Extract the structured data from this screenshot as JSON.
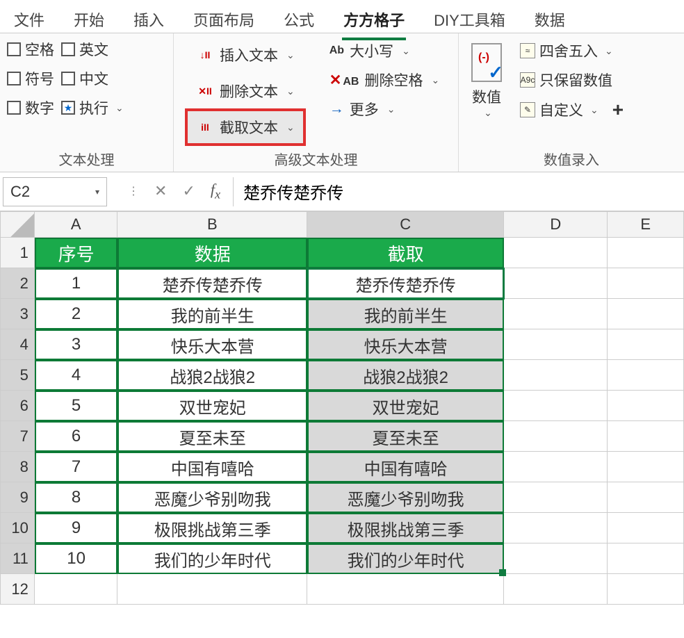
{
  "tabs": [
    "文件",
    "开始",
    "插入",
    "页面布局",
    "公式",
    "方方格子",
    "DIY工具箱",
    "数据"
  ],
  "active_tab": "方方格子",
  "ribbon": {
    "group1": {
      "label": "文本处理",
      "checks_left": [
        "空格",
        "符号",
        "数字"
      ],
      "checks_right": [
        "英文",
        "中文",
        "执行"
      ]
    },
    "group2": {
      "label": "高级文本处理",
      "items": [
        "插入文本",
        "删除文本",
        "截取文本"
      ],
      "right_items": [
        "大小写",
        "删除空格",
        "更多"
      ]
    },
    "group3": {
      "big_label": "数值",
      "items": [
        "四舍五入",
        "只保留数值",
        "自定义"
      ],
      "label": "数值录入"
    }
  },
  "namebox": "C2",
  "formula": "楚乔传楚乔传",
  "columns": [
    "A",
    "B",
    "C",
    "D",
    "E"
  ],
  "col_widths": [
    "wA",
    "wB",
    "wC",
    "wD",
    "wE"
  ],
  "header_row": [
    "序号",
    "数据",
    "截取"
  ],
  "rows": [
    {
      "n": "1",
      "a": "1",
      "b": "楚乔传楚乔传",
      "c": "楚乔传楚乔传"
    },
    {
      "n": "2",
      "a": "2",
      "b": "我的前半生",
      "c": "我的前半生"
    },
    {
      "n": "3",
      "a": "3",
      "b": "快乐大本营",
      "c": "快乐大本营"
    },
    {
      "n": "4",
      "a": "4",
      "b": "战狼2战狼2",
      "c": "战狼2战狼2"
    },
    {
      "n": "5",
      "a": "5",
      "b": "双世宠妃",
      "c": "双世宠妃"
    },
    {
      "n": "6",
      "a": "6",
      "b": "夏至未至",
      "c": "夏至未至"
    },
    {
      "n": "7",
      "a": "7",
      "b": "中国有嘻哈",
      "c": "中国有嘻哈"
    },
    {
      "n": "8",
      "a": "8",
      "b": "恶魔少爷别吻我",
      "c": "恶魔少爷别吻我"
    },
    {
      "n": "9",
      "a": "9",
      "b": "极限挑战第三季",
      "c": "极限挑战第三季"
    },
    {
      "n": "10",
      "a": "10",
      "b": "我们的少年时代",
      "c": "我们的少年时代"
    }
  ],
  "chart_data": {
    "type": "table",
    "columns": [
      "序号",
      "数据",
      "截取"
    ],
    "rows": [
      [
        1,
        "楚乔传楚乔传",
        "楚乔传楚乔传"
      ],
      [
        2,
        "我的前半生",
        "我的前半生"
      ],
      [
        3,
        "快乐大本营",
        "快乐大本营"
      ],
      [
        4,
        "战狼2战狼2",
        "战狼2战狼2"
      ],
      [
        5,
        "双世宠妃",
        "双世宠妃"
      ],
      [
        6,
        "夏至未至",
        "夏至未至"
      ],
      [
        7,
        "中国有嘻哈",
        "中国有嘻哈"
      ],
      [
        8,
        "恶魔少爷别吻我",
        "恶魔少爷别吻我"
      ],
      [
        9,
        "极限挑战第三季",
        "极限挑战第三季"
      ],
      [
        10,
        "我们的少年时代",
        "我们的少年时代"
      ]
    ]
  }
}
